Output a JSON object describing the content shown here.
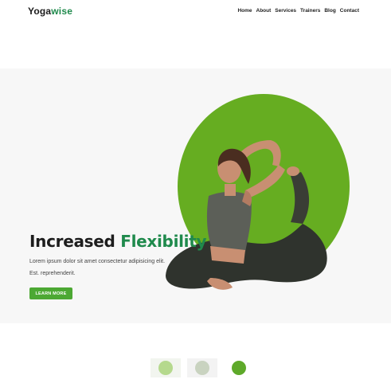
{
  "brand": {
    "name_part1": "Yoga",
    "name_part2": "wise"
  },
  "nav": {
    "items": [
      "Home",
      "About",
      "Services",
      "Trainers",
      "Blog",
      "Contact"
    ]
  },
  "hero": {
    "headline_part1": "Increased ",
    "headline_part2": "Flexibility",
    "description_line1": "Lorem ipsum dolor sit amet consectetur adipisicing elit.",
    "description_line2": "Est. reprehenderit.",
    "cta_label": "LEARN MORE"
  },
  "colors": {
    "brand_green": "#1f8a4c",
    "accent_green": "#66ad21",
    "button_green": "#4ca833"
  },
  "icons": {
    "thumbnails": [
      "yoga-slide-thumbnail-1",
      "yoga-slide-thumbnail-2",
      "yoga-slide-thumbnail-3"
    ]
  }
}
